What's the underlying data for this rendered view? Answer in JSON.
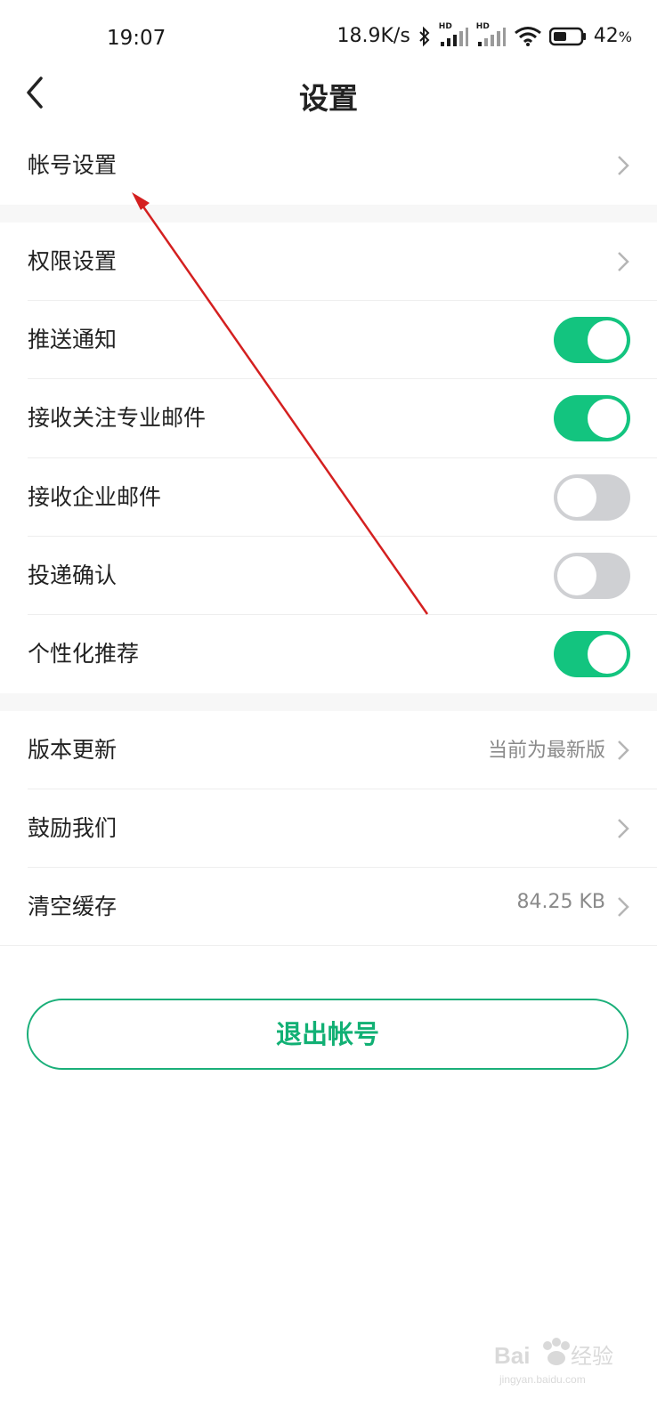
{
  "status_bar": {
    "time": "19:07",
    "net_speed": "18.9K/s",
    "sim1_tag": "HD",
    "sim2_tag": "HD",
    "battery": "42",
    "battery_unit": "%"
  },
  "header": {
    "title": "设置"
  },
  "rows": {
    "account": {
      "label": "帐号设置"
    },
    "permission": {
      "label": "权限设置"
    },
    "push": {
      "label": "推送通知",
      "on": true
    },
    "follow_mail": {
      "label": "接收关注专业邮件",
      "on": true
    },
    "company_mail": {
      "label": "接收企业邮件",
      "on": false
    },
    "delivery": {
      "label": "投递确认",
      "on": false
    },
    "personalized": {
      "label": "个性化推荐",
      "on": true
    },
    "version": {
      "label": "版本更新",
      "value": "当前为最新版"
    },
    "encourage": {
      "label": "鼓励我们"
    },
    "cache": {
      "label": "清空缓存",
      "value": "84.25 KB"
    }
  },
  "logout_label": "退出帐号",
  "watermark": {
    "text": "Bai du 经验",
    "sub": "jingyan.baidu.com"
  },
  "colors": {
    "accent": "#13c47f",
    "toggle_off": "#cfd0d3",
    "annotation_arrow": "#d42020"
  }
}
